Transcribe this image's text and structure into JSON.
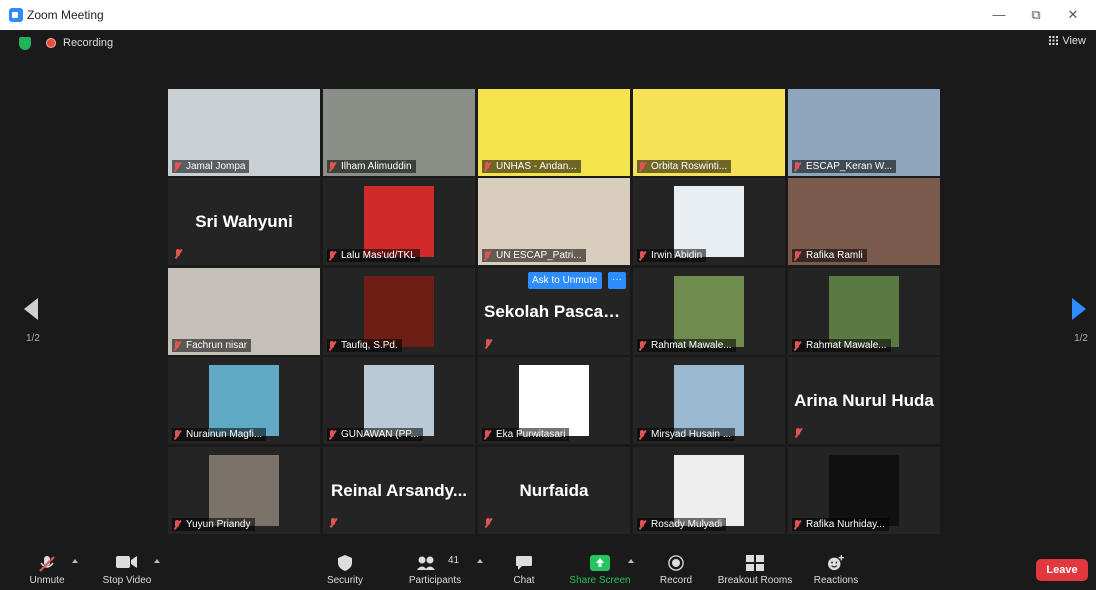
{
  "window": {
    "title": "Zoom Meeting",
    "minimize": "—",
    "restore": "⧉",
    "close": "✕"
  },
  "topbar": {
    "recording_label": "Recording",
    "view_label": "View"
  },
  "paging": {
    "left": "1/2",
    "right": "1/2"
  },
  "ask_to_unmute": {
    "label": "Ask to Unmute",
    "more": "···"
  },
  "tiles": [
    {
      "name": "Jamal Jompa",
      "bg": "#c9d0d4",
      "active": true,
      "kind": "video"
    },
    {
      "name": "Ilham Alimuddin",
      "bg": "#8a8f88",
      "kind": "video"
    },
    {
      "name": "UNHAS - Andan...",
      "bg": "#f3e34d",
      "kind": "video"
    },
    {
      "name": "Orbita Roswinti...",
      "bg": "#f5e357",
      "kind": "video"
    },
    {
      "name": "ESCAP_Keran W...",
      "bg": "#8fa7bd",
      "kind": "video"
    },
    {
      "big": "Sri Wahyuni",
      "kind": "text"
    },
    {
      "name": "Lalu Mas'ud/TKL",
      "bg": "#d02a2a",
      "kind": "photo"
    },
    {
      "name": "UN ESCAP_Patri...",
      "bg": "#d9cdbd",
      "kind": "video"
    },
    {
      "name": "Irwin Abidin",
      "bg": "#e8eef2",
      "kind": "photo"
    },
    {
      "name": "Rafika Ramli",
      "bg": "#7a5a4c",
      "kind": "video"
    },
    {
      "name": "Fachrun nisar",
      "bg": "#c5c1b8",
      "kind": "video"
    },
    {
      "name": "Taufiq, S.Pd.",
      "bg": "#6e1e14",
      "kind": "photo"
    },
    {
      "big": "Sekolah Pascasa...",
      "kind": "text"
    },
    {
      "name": "Rahmat Mawale...",
      "bg": "#6f8c4e",
      "kind": "photo"
    },
    {
      "name": "Rahmat Mawale...",
      "bg": "#5a7a44",
      "kind": "photo"
    },
    {
      "name": "Nurainun Magfi...",
      "bg": "#5fa9c4",
      "kind": "photo"
    },
    {
      "name": "GUNAWAN (PP...",
      "bg": "#b9c9d8",
      "kind": "photo"
    },
    {
      "name": "Eka Purwitasari",
      "bg": "#ffffff",
      "kind": "photo"
    },
    {
      "name": "Mirsyad Husain ...",
      "bg": "#9ab8cf",
      "kind": "photo"
    },
    {
      "big": "Arina Nurul Huda",
      "kind": "text"
    },
    {
      "name": "Yuyun Priandy",
      "bg": "#7b7369",
      "kind": "photo"
    },
    {
      "big": "Reinal Arsandy...",
      "kind": "text"
    },
    {
      "big": "Nurfaida",
      "kind": "text"
    },
    {
      "name": "Rosady Mulyadi",
      "bg": "#eeeeee",
      "kind": "photo"
    },
    {
      "name": "Rafika Nurhiday...",
      "bg": "#111111",
      "kind": "photo"
    }
  ],
  "toolbar": {
    "unmute": "Unmute",
    "stop_video": "Stop Video",
    "security": "Security",
    "participants": "Participants",
    "participants_count": "41",
    "chat": "Chat",
    "share_screen": "Share Screen",
    "record": "Record",
    "breakout_rooms": "Breakout Rooms",
    "reactions": "Reactions",
    "leave": "Leave"
  },
  "colors": {
    "accent": "#2d8cff",
    "share": "#22c55e",
    "leave": "#e0383e",
    "active_speaker": "#d5e36b"
  }
}
